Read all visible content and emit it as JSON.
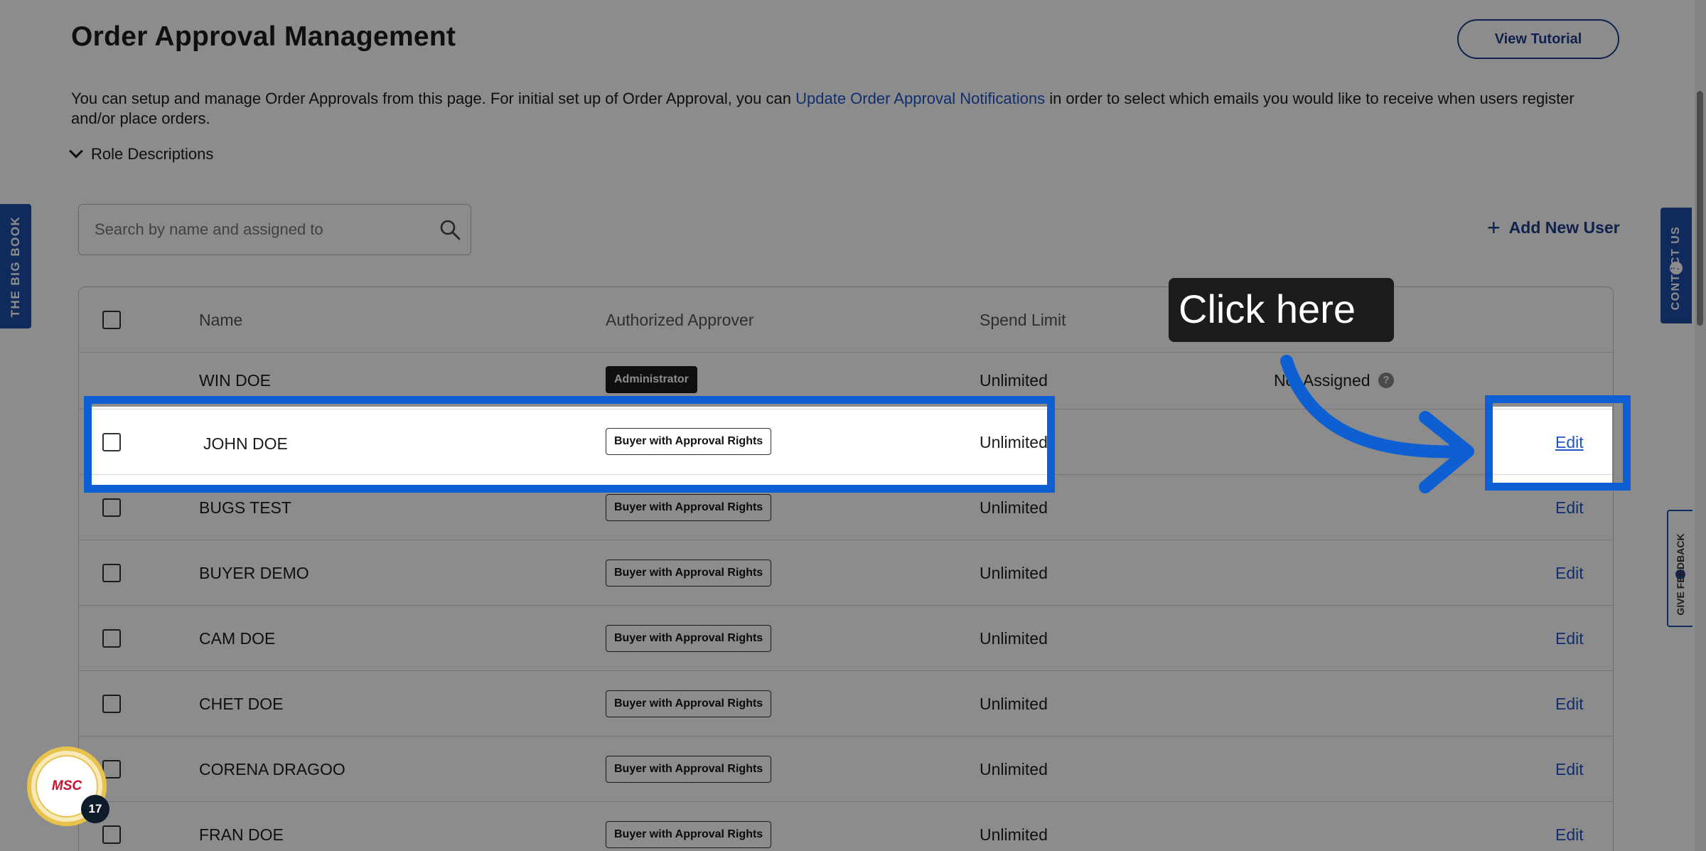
{
  "page": {
    "title": "Order Approval Management",
    "tutorial_button": "View Tutorial",
    "intro_before": "You can setup and manage Order Approvals from this page. For initial set up of Order Approval, you can ",
    "intro_link": "Update Order Approval Notifications",
    "intro_after": " in order to select which emails you would like to receive when users register and/or place orders.",
    "role_descriptions": "Role Descriptions",
    "search_placeholder": "Search by name and assigned to",
    "add_user": "Add New User"
  },
  "table": {
    "headers": {
      "name": "Name",
      "approver": "Authorized Approver",
      "limit": "Spend Limit"
    },
    "rows": [
      {
        "name": "WIN DOE",
        "role": "Administrator",
        "limit": "Unlimited",
        "assigned": "Not Assigned",
        "edit": ""
      },
      {
        "name": "JOHN DOE",
        "role": "Buyer with Approval Rights",
        "limit": "Unlimited",
        "assigned": "",
        "edit": "Edit"
      },
      {
        "name": "BUGS TEST",
        "role": "Buyer with Approval Rights",
        "limit": "Unlimited",
        "assigned": "",
        "edit": "Edit"
      },
      {
        "name": "BUYER DEMO",
        "role": "Buyer with Approval Rights",
        "limit": "Unlimited",
        "assigned": "",
        "edit": "Edit"
      },
      {
        "name": "CAM DOE",
        "role": "Buyer with Approval Rights",
        "limit": "Unlimited",
        "assigned": "",
        "edit": "Edit"
      },
      {
        "name": "CHET DOE",
        "role": "Buyer with Approval Rights",
        "limit": "Unlimited",
        "assigned": "",
        "edit": "Edit"
      },
      {
        "name": "CORENA DRAGOO",
        "role": "Buyer with Approval Rights",
        "limit": "Unlimited",
        "assigned": "",
        "edit": "Edit"
      },
      {
        "name": "FRAN DOE",
        "role": "Buyer with Approval Rights",
        "limit": "Unlimited",
        "assigned": "",
        "edit": "Edit"
      }
    ]
  },
  "side_tabs": {
    "big_book": "THE BIG BOOK",
    "contact": "CONTACT US",
    "feedback": "GIVE FEEDBACK"
  },
  "badge": {
    "logo": "MSC",
    "count": "17"
  },
  "tooltip": {
    "text": "Click here"
  },
  "colors": {
    "accent": "#1e3c8c",
    "highlight": "#0e5fd1",
    "link": "#1e55c8"
  }
}
